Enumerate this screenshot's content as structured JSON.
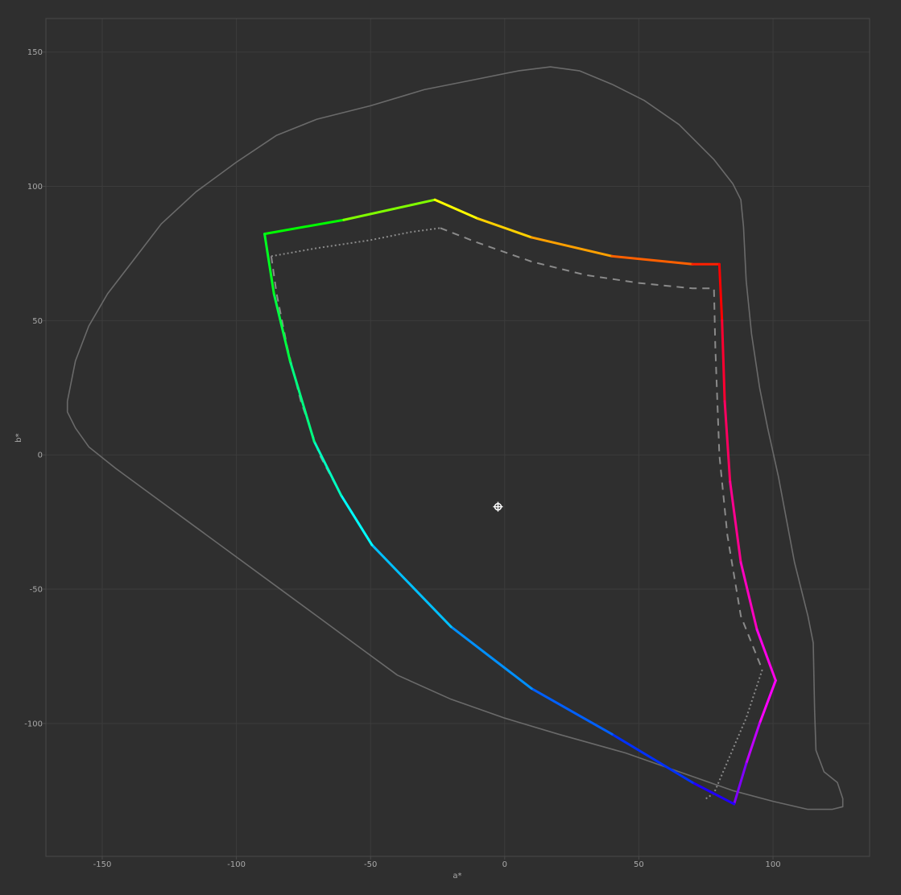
{
  "chart_data": {
    "type": "line",
    "xlabel": "a*",
    "ylabel": "b*",
    "xlim": [
      -171,
      136
    ],
    "ylim": [
      -149.5,
      162.5
    ],
    "grid": true,
    "x_ticks": [
      -150,
      -100,
      -50,
      0,
      50,
      100
    ],
    "y_ticks": [
      150,
      100,
      50,
      0,
      -50,
      -100
    ],
    "colors": {
      "background": "#2f2f2f",
      "grid": "#3c3c3c",
      "frame": "#4a4a4a",
      "outline": "#6a6a6a",
      "reference_gamut": "#8a8a8a",
      "marker": "#ffffff"
    },
    "white_point": {
      "a": -2.5,
      "b": -19.3
    },
    "series": [
      {
        "style": "outline",
        "points": [
          [
            -163,
            20
          ],
          [
            -160,
            35
          ],
          [
            -155,
            48
          ],
          [
            -148,
            60
          ],
          [
            -138,
            73
          ],
          [
            -128,
            86
          ],
          [
            -115,
            98
          ],
          [
            -100,
            109
          ],
          [
            -85,
            119
          ],
          [
            -70,
            125
          ],
          [
            -50,
            130
          ],
          [
            -30,
            136
          ],
          [
            -10,
            140
          ],
          [
            5,
            143
          ],
          [
            17,
            144.5
          ],
          [
            28,
            143
          ],
          [
            40,
            138
          ],
          [
            52,
            132
          ],
          [
            65,
            123
          ],
          [
            78,
            110
          ],
          [
            85,
            101
          ],
          [
            88,
            95
          ],
          [
            89,
            85
          ],
          [
            90,
            65
          ],
          [
            92,
            45
          ],
          [
            95,
            25
          ],
          [
            98,
            10
          ],
          [
            102,
            -8
          ],
          [
            108,
            -40
          ],
          [
            113,
            -60
          ],
          [
            115,
            -70
          ],
          [
            115.5,
            -95
          ],
          [
            116,
            -110
          ],
          [
            119,
            -118
          ],
          [
            124,
            -122
          ],
          [
            126,
            -128
          ],
          [
            126,
            -131
          ],
          [
            122,
            -132
          ],
          [
            113,
            -132
          ],
          [
            100,
            -129
          ],
          [
            85,
            -125
          ],
          [
            65,
            -118
          ],
          [
            45,
            -111
          ],
          [
            20,
            -104
          ],
          [
            0,
            -98
          ],
          [
            -20,
            -91
          ],
          [
            -40,
            -82
          ],
          [
            -55,
            -71
          ],
          [
            -70,
            -60
          ],
          [
            -85,
            -49
          ],
          [
            -100,
            -38
          ],
          [
            -115,
            -27
          ],
          [
            -130,
            -16
          ],
          [
            -145,
            -5
          ],
          [
            -155,
            3
          ],
          [
            -160,
            10
          ],
          [
            -163,
            16
          ],
          [
            -163,
            20
          ]
        ]
      },
      {
        "style": "reference-dashed",
        "points": [
          [
            -24,
            84.5
          ],
          [
            -10,
            79
          ],
          [
            10,
            72
          ],
          [
            30,
            67
          ],
          [
            50,
            64
          ],
          [
            70,
            62
          ],
          [
            78,
            62
          ],
          [
            78.5,
            40
          ],
          [
            80,
            0
          ],
          [
            83,
            -30
          ],
          [
            88,
            -60
          ],
          [
            96,
            -80
          ]
        ]
      },
      {
        "style": "reference-dotted",
        "points": [
          [
            -87,
            74
          ],
          [
            -70,
            77
          ],
          [
            -50,
            80
          ],
          [
            -35,
            83
          ],
          [
            -24,
            84.5
          ]
        ]
      },
      {
        "style": "reference-dotted",
        "points": [
          [
            96,
            -80
          ],
          [
            90,
            -98
          ],
          [
            84,
            -112
          ],
          [
            78,
            -126
          ],
          [
            75,
            -128
          ]
        ]
      },
      {
        "style": "reference-dashed",
        "points": [
          [
            -87,
            74
          ],
          [
            -85,
            60
          ],
          [
            -81,
            40
          ],
          [
            -76,
            20
          ],
          [
            -69,
            0
          ],
          [
            -61,
            -15
          ],
          [
            -49,
            -34
          ]
        ]
      },
      {
        "style": "gamut",
        "points": [
          [
            -89.5,
            82.3,
            "#00ff00"
          ],
          [
            -60,
            87.5,
            "#80ff00"
          ],
          [
            -26,
            95,
            "#ffff00"
          ],
          [
            -10,
            88,
            "#ffd000"
          ],
          [
            10,
            81,
            "#ffa000"
          ],
          [
            40,
            74,
            "#ff6000"
          ],
          [
            70,
            71,
            "#ff2000"
          ],
          [
            80,
            71,
            "#ff0000"
          ],
          [
            81,
            50,
            "#ff0030"
          ],
          [
            82,
            20,
            "#ff0060"
          ],
          [
            84,
            -10,
            "#ff0090"
          ],
          [
            88,
            -40,
            "#ff00c0"
          ],
          [
            94,
            -65,
            "#ff00e8"
          ],
          [
            101,
            -84,
            "#ff00ff"
          ],
          [
            95,
            -100,
            "#c000ff"
          ],
          [
            90,
            -115,
            "#8000ff"
          ],
          [
            85.5,
            -130,
            "#2000ff"
          ],
          [
            70,
            -122,
            "#0030ff"
          ],
          [
            40,
            -104,
            "#0060ff"
          ],
          [
            10,
            -87,
            "#0090ff"
          ],
          [
            -20,
            -64,
            "#00c0ff"
          ],
          [
            -49.5,
            -33.5,
            "#00ffff"
          ],
          [
            -61,
            -15,
            "#00ffc0"
          ],
          [
            -71,
            5,
            "#00ff80"
          ],
          [
            -80,
            35,
            "#00ff40"
          ],
          [
            -86,
            60,
            "#00ff20"
          ],
          [
            -89.5,
            82.3,
            "#00ff00"
          ]
        ]
      }
    ]
  }
}
